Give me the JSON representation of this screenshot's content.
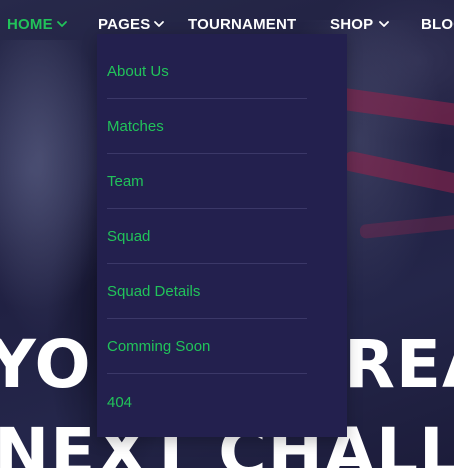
{
  "nav": {
    "items": [
      {
        "label": "HOME",
        "has_dropdown": true,
        "active": true
      },
      {
        "label": "PAGES",
        "has_dropdown": true,
        "active": false
      },
      {
        "label": "TOURNAMENT",
        "has_dropdown": false,
        "active": false
      },
      {
        "label": "SHOP",
        "has_dropdown": true,
        "active": false
      },
      {
        "label": "BLOG",
        "has_dropdown": false,
        "active": false
      }
    ]
  },
  "dropdown": {
    "parent": "PAGES",
    "items": [
      {
        "label": "About Us"
      },
      {
        "label": "Matches"
      },
      {
        "label": "Team"
      },
      {
        "label": "Squad"
      },
      {
        "label": "Squad Details"
      },
      {
        "label": "Comming Soon"
      },
      {
        "label": "404"
      }
    ]
  },
  "hero": {
    "line1": "YOU ARE READY FOR",
    "line2": "NEXT CHALLENGE"
  },
  "colors": {
    "accent": "#21c35a",
    "nav_text": "#ffffff",
    "dropdown_bg": "#23204e",
    "divider": "#3b3868",
    "hero_text": "#ffffff",
    "streak": "#96234b"
  },
  "icons": {
    "dropdown_indicator": "chevron-down-icon"
  }
}
